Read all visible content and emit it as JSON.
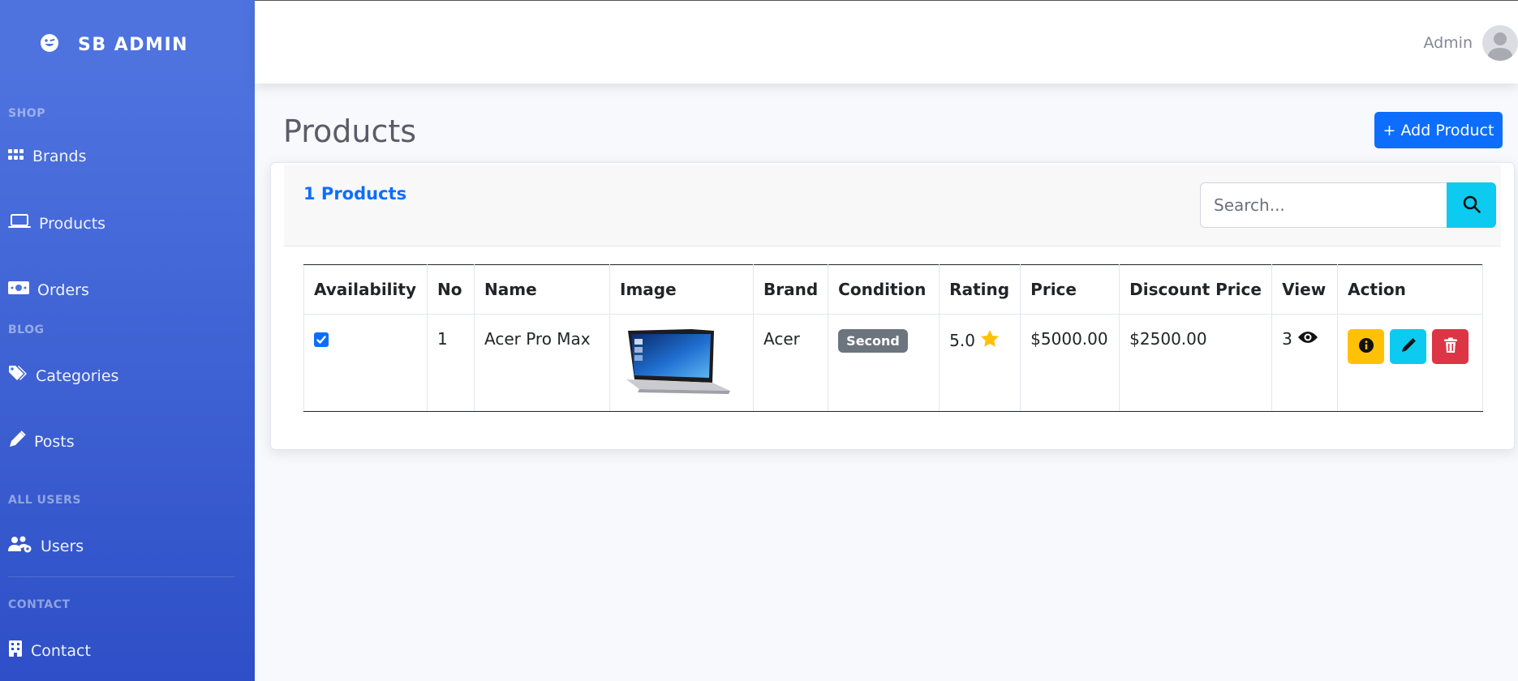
{
  "sidebar": {
    "brand": "SB ADMIN",
    "headings": {
      "shop": "SHOP",
      "blog": "BLOG",
      "users": "ALL USERS",
      "contact": "CONTACT"
    },
    "items": [
      {
        "label": "Brands",
        "icon": "grid-icon"
      },
      {
        "label": "Products",
        "icon": "laptop-icon"
      },
      {
        "label": "Orders",
        "icon": "money-icon"
      },
      {
        "label": "Categories",
        "icon": "tags-icon"
      },
      {
        "label": "Posts",
        "icon": "pen-icon"
      },
      {
        "label": "Users",
        "icon": "users-gear-icon"
      },
      {
        "label": "Contact",
        "icon": "building-icon"
      }
    ]
  },
  "topbar": {
    "user_name": "Admin"
  },
  "page": {
    "title": "Products",
    "add_button": "+ Add Product"
  },
  "card": {
    "count_label": "1 Products",
    "search_placeholder": "Search..."
  },
  "table": {
    "columns": [
      "Availability",
      "No",
      "Name",
      "Image",
      "Brand",
      "Condition",
      "Rating",
      "Price",
      "Discount Price",
      "View",
      "Action"
    ],
    "rows": [
      {
        "available": true,
        "no": "1",
        "name": "Acer Pro Max",
        "image": "laptop-image",
        "brand": "Acer",
        "condition": "Second",
        "rating": "5.0",
        "price": "$5000.00",
        "discount_price": "$2500.00",
        "views": "3"
      }
    ]
  },
  "colors": {
    "sidebar": "#4e73df",
    "primary": "#0d6efd",
    "info": "#0dcaf0",
    "warning": "#ffc107",
    "danger": "#dc3545",
    "secondary": "#6c757d"
  }
}
